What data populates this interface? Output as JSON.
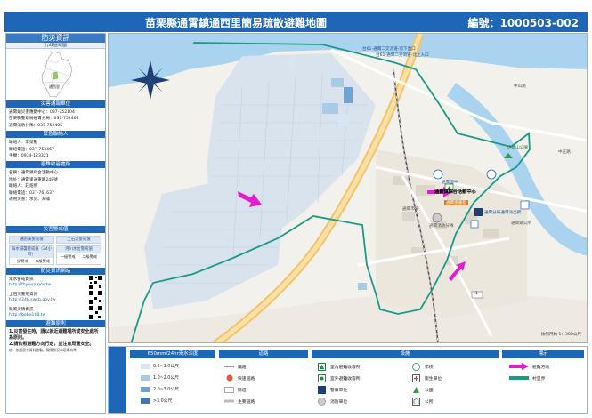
{
  "header": {
    "title": "苗栗縣通霄鎮通西里簡易疏散避難地圖",
    "code": "編號：1000503-002"
  },
  "sidebar": {
    "section_title": "防災資訊",
    "admin_head": "行政區域圖",
    "admin_label": "通西里",
    "agency_head": "災害通報單位",
    "agency_lines": [
      "通霄鎮災害應變中心：037-752104",
      "苗栗縣警察局通霄分局：037-752464",
      "通霄消防分隊：037-752405"
    ],
    "contact_head": "緊急聯絡人",
    "contact_lines": [
      "聯絡人：李榮勳",
      "聯絡電話：037-753467",
      "手機：0934-123321"
    ],
    "shelter_head": "避難收容處所",
    "shelter_lines": [
      "名稱：通霄鎮綜合活動中心",
      "地址：通霄里通東路248號",
      "聯絡人：莊炤傑",
      "聯絡電話：037-761637",
      "適用災害：水災、海嘯"
    ],
    "capacity_head": "災害警戒值",
    "capacity_boxes": [
      {
        "title": "通苗溪警戒值",
        "a": "",
        "b": ""
      },
      {
        "title": "土石流警戒值",
        "a": "",
        "b": ""
      },
      {
        "title": "海水侵襲警戒值（24小時）",
        "a": "一級警戒",
        "b": "二級警戒"
      },
      {
        "title": "河川水位警戒值",
        "a": "一級警戒",
        "b": "二級警戒"
      }
    ],
    "links_head": "防災資訊網站",
    "links": [
      {
        "name": "淹水警戒資訊",
        "url": "http://fhy.wra.gov.tw"
      },
      {
        "name": "土石流警戒資訊",
        "url": "http://246.swcb.gov.tw"
      },
      {
        "name": "颱風災情資訊",
        "url": "http://bobe168.tw"
      }
    ],
    "notes_head": "避難原則",
    "notes": [
      "1.災害發生時，請以就近避難場所或安全處所為原則。",
      "2.請依照避難方向行走，並注意周遭安全。"
    ],
    "source": "註：依據現有資料繪製，實際狀況以現場為準"
  },
  "map": {
    "labels": {
      "road_top1": "台61-通霄二交流道-南下出口",
      "road_top2": "台61-通霄二交流道-北上入口",
      "road_mid": "中山路",
      "shelter": "通霄鎮綜合活動中心",
      "school": "通霄國中",
      "police": "通霄分局通霄派出所",
      "library": "通霄圖書館",
      "townhall": "通霄鎮公所",
      "park": "虎頭山公園",
      "fire": "通霄消防分隊",
      "market": "通霄市場",
      "road_east": "中正路",
      "tw1": "1",
      "scale": "比例尺約 1：300公尺"
    }
  },
  "legend": {
    "flood_head": "650mm/24hr淹水深度",
    "flood": [
      {
        "label": "0.5~1.0公尺",
        "color": "#d6e6f2"
      },
      {
        "label": "1.0~2.0公尺",
        "color": "#a9cbe6"
      },
      {
        "label": "2.0~3.0公尺",
        "color": "#6fa3d1"
      },
      {
        "label": ">3.0公尺",
        "color": "#3d78b8"
      }
    ],
    "road_head": "道路",
    "roads": [
      "鐵路",
      "快速道路",
      "縣道",
      "主要道路"
    ],
    "facility_head": "設施",
    "facilities": [
      "室內避難收容所",
      "室外避難收容所",
      "警察單位",
      "消防單位",
      "學校",
      "衛生單位",
      "公園",
      "公所"
    ],
    "hint_head": "標示",
    "hints": [
      "避難方向",
      "村里界"
    ],
    "colors": {
      "boundary": "#1a9a88",
      "arrow": "#e21ccf",
      "primary": "#1d66b8"
    }
  }
}
